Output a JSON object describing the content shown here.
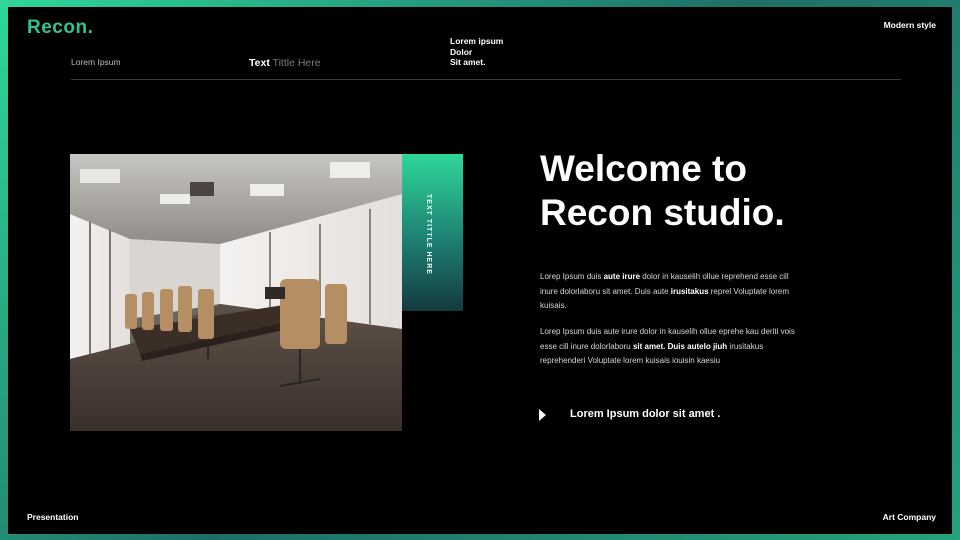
{
  "brand": {
    "name": "Recon",
    "dot": ".",
    "accent": "#31c48d"
  },
  "header": {
    "top_right": "Modern style",
    "nav_item_1": "Lorem Ipsum",
    "nav_item_2_strong": "Text",
    "nav_item_2_light": "Tittle Here",
    "nav_item_3_line_1": "Lorem ipsum",
    "nav_item_3_line_2": "Dolor",
    "nav_item_3_line_3": "Sit amet."
  },
  "side_tab": {
    "label": "TEXT TITTLE HERE"
  },
  "main": {
    "headline_line_1": "Welcome to",
    "headline_line_2": "Recon studio.",
    "para_1": {
      "t1": "Lorep  Ipsum duis ",
      "b1": "aute irure",
      "t2": " dolor in kauselih ollue reprehend esse cill inure dolorlaboru sit amet. Duis aute ",
      "b2": "irusitakus",
      "t3": " reprel Voluptate lorem kuisais."
    },
    "para_2": {
      "t1": "Lorep  Ipsum duis aute irure dolor in kauselih ollue eprehe kau deriti vois esse cill inure dolorlaboru ",
      "b1": "sit amet. Duis autelo jiuh",
      "t2": " irusitakus reprehenderi Voluptate lorem kuisais iouisin kaesiu"
    },
    "cta": "Lorem Ipsum dolor sit amet ."
  },
  "footer": {
    "left": "Presentation",
    "right": "Art Company"
  },
  "image": {
    "subject": "conference-room-photo"
  }
}
